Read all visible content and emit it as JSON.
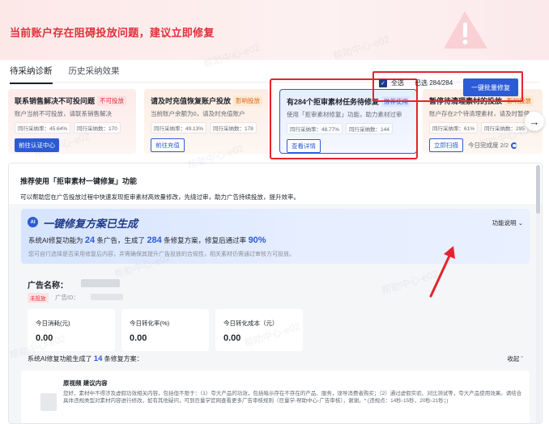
{
  "banner": {
    "title": "当前账户存在阻碍投放问题，建议立即修复"
  },
  "tabs": [
    {
      "label": "待采纳诊断"
    },
    {
      "label": "历史采纳效果"
    }
  ],
  "cards": [
    {
      "title": "联系销售解决不可投问题",
      "tag": "不可投放",
      "desc": "账户当前不可投放，请联系销售解决",
      "metrics": [
        "同行采纳率：45.64%",
        "同行采纳数：170"
      ],
      "action": "前往认证中心"
    },
    {
      "title": "请及时充值恢复账户投放",
      "tag": "影响投放",
      "desc": "当前账户余额为0，请及时充值账户",
      "metrics": [
        "同行采纳率：49.13%",
        "同行采纳数：178"
      ],
      "action": "前往充值"
    },
    {
      "title": "有284个拒审素材任务待修复",
      "tag": "推荐使用",
      "desc": "使用「拒审素材修复」功能，助力素材过审",
      "metrics": [
        "同行采纳率：48.77%",
        "同行采纳数：144"
      ],
      "action": "查看详情"
    },
    {
      "title": "暂停待清理素材的投放",
      "tag": "影响投放",
      "desc": "账户存在2个待清理素材，请及时暂停",
      "metrics": [
        "同行采纳率：61%",
        "同行采纳数：295"
      ],
      "action": "立即扫描",
      "progress": "今日完成度 2/2"
    }
  ],
  "panel": {
    "title": "推荐使用「拒审素材一键修复」功能",
    "subtitle": "可以帮助您在广告投放过程中快速发现拒审素材高效量修改，先绕过审，助力广告持续投放，提升效率。"
  },
  "ai": {
    "badge": "AI",
    "title": "一键修复方案已生成",
    "link": "功能说明",
    "line_prefix": "系统AI修复功能为",
    "ads_count": "24",
    "line_mid1": "条广告，生成了",
    "plans_count": "284",
    "line_mid2": "条修复方案，修复后通过率",
    "rate": "90%",
    "note": "您可自行选择是否采用修复后内容，并需确保其提升广告投放的合规性，相关素材仍需通过审核方可投放。"
  },
  "select": {
    "all_label": "全选",
    "count_label": "已选 284/284",
    "batch_button": "一键批量修复"
  },
  "ad": {
    "name_label": "广告名称：",
    "status": "未投放",
    "id_label": "广告ID：",
    "stats": [
      {
        "label": "今日消耗(元)",
        "value": "0.00"
      },
      {
        "label": "今日转化率(%)",
        "value": "0.00"
      },
      {
        "label": "今日转化成本（元）",
        "value": "0.00"
      }
    ]
  },
  "repair": {
    "prefix": "系统AI修复功能生成了",
    "count": "14",
    "suffix": "条修复方案：",
    "collapse": "收起"
  },
  "item": {
    "head": "原视频 建议内容",
    "body": "您好，素材中不得涉及虚假功效相关内容，包括但不限于：（1）夸大产品的功效，包括暗示存在不存在的产品、服务，误导消费者购买；（2）通过虚假实验、对比测试等，夸大产品使用效果。请结合具体违规类型对素材内容进行修改，如有其他疑问，可到巨量学官网查看更多广告审核规则（巨量学-帮助中心-广告审核），谢谢。* (违规点：14秒-15秒，20秒-21秒；)"
  },
  "watermark": "帮助中心-e02"
}
